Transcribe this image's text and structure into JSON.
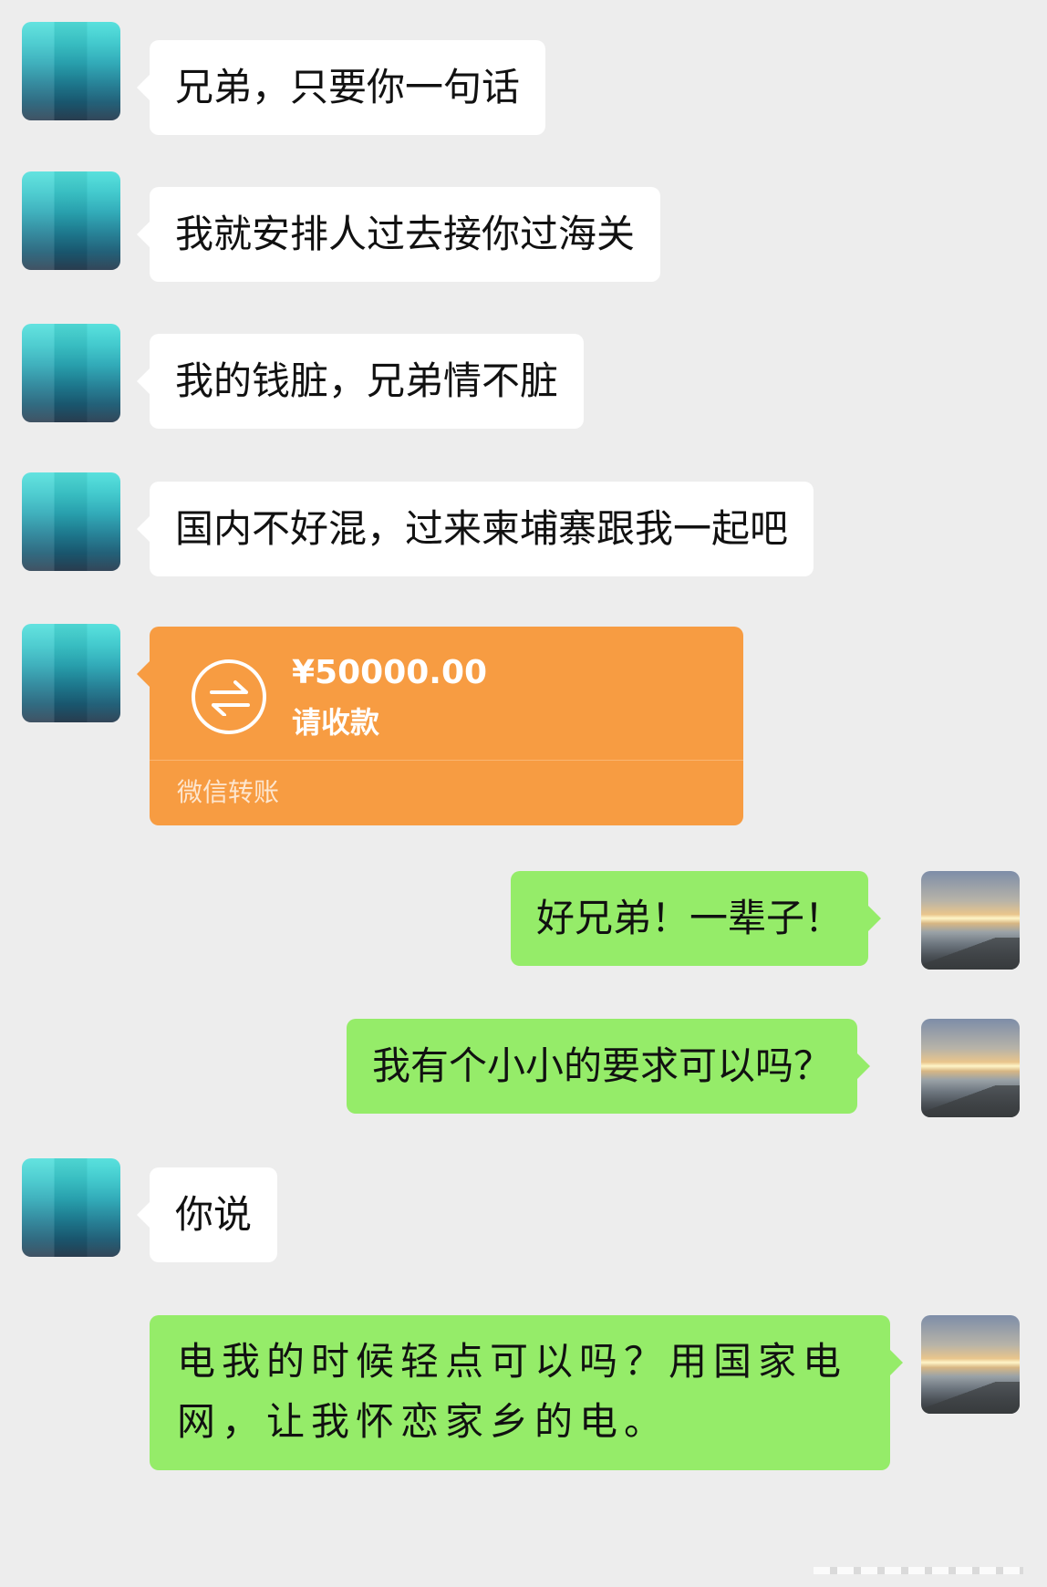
{
  "messages": [
    {
      "side": "in",
      "text": "兄弟，只要你一句话"
    },
    {
      "side": "in",
      "text": "我就安排人过去接你过海关"
    },
    {
      "side": "in",
      "text": "我的钱脏，兄弟情不脏"
    },
    {
      "side": "in",
      "text": "国内不好混，过来柬埔寨跟我一起吧"
    },
    {
      "side": "in",
      "type": "transfer",
      "amount": "¥50000.00",
      "status": "请收款",
      "footer": "微信转账",
      "color": "#f79c42"
    },
    {
      "side": "out",
      "text": "好兄弟！一辈子！"
    },
    {
      "side": "out",
      "text": "我有个小小的要求可以吗？"
    },
    {
      "side": "in",
      "text": "你说"
    },
    {
      "side": "out",
      "text": "电我的时候轻点可以吗？用国家电网，让我怀恋家乡的电。"
    }
  ],
  "colors": {
    "background": "#ededed",
    "incoming_bubble": "#ffffff",
    "outgoing_bubble": "#95ec69",
    "transfer_card": "#f79c42"
  },
  "icons": {
    "transfer": "transfer-arrows-icon",
    "contact_avatar": "mosaic-blurred-avatar",
    "self_avatar": "sunset-avatar"
  }
}
